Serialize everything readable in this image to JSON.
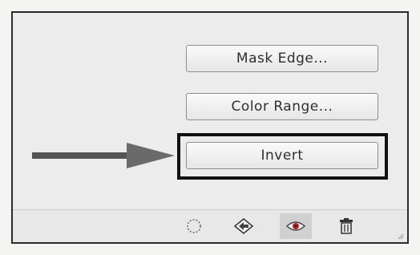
{
  "buttons": {
    "mask_edge": "Mask Edge...",
    "color_range": "Color Range...",
    "invert": "Invert"
  },
  "toolbar": {
    "icons": [
      "dotted-selection-icon",
      "load-selection-icon",
      "eye-icon",
      "trash-icon"
    ]
  },
  "colors": {
    "highlight_border": "#111111",
    "arrow": "#555555"
  }
}
